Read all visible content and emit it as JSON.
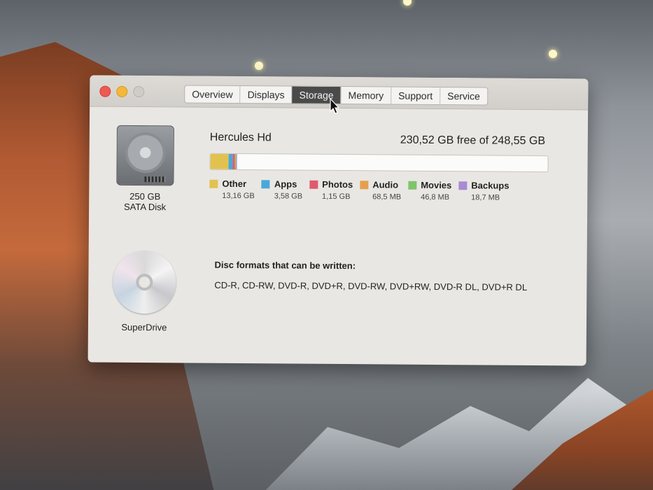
{
  "window": {
    "tabs": [
      {
        "label": "Overview"
      },
      {
        "label": "Displays"
      },
      {
        "label": "Storage"
      },
      {
        "label": "Memory"
      },
      {
        "label": "Support"
      },
      {
        "label": "Service"
      }
    ],
    "active_tab": "Storage"
  },
  "devices": {
    "disk": {
      "capacity": "250 GB",
      "type": "SATA Disk"
    },
    "optical": {
      "name": "SuperDrive"
    }
  },
  "storage": {
    "name": "Hercules Hd",
    "free_text": "230,52 GB free of 248,55 GB",
    "categories": [
      {
        "label": "Other",
        "size": "13,16 GB",
        "color": "#e2c24f"
      },
      {
        "label": "Apps",
        "size": "3,58 GB",
        "color": "#4aa8d8"
      },
      {
        "label": "Photos",
        "size": "1,15 GB",
        "color": "#e05b6f"
      },
      {
        "label": "Audio",
        "size": "68,5 MB",
        "color": "#e5a04e"
      },
      {
        "label": "Movies",
        "size": "46,8 MB",
        "color": "#7fc46b"
      },
      {
        "label": "Backups",
        "size": "18,7 MB",
        "color": "#a78bd4"
      }
    ],
    "bar_fractions": [
      0.053,
      0.0144,
      0.0046,
      0.0028,
      0.0019,
      0.0008
    ]
  },
  "formats": {
    "title": "Disc formats that can be written:",
    "list": "CD-R, CD-RW, DVD-R, DVD+R, DVD-RW, DVD+RW, DVD-R DL, DVD+R DL"
  }
}
